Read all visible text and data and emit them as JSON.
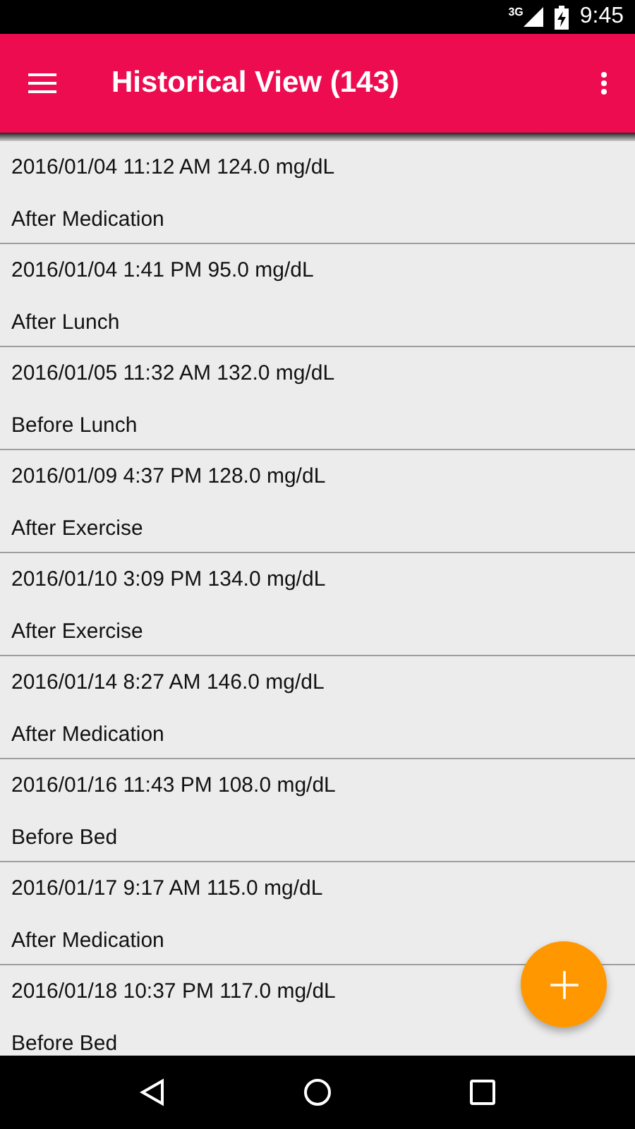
{
  "status_bar": {
    "network": "3G",
    "time": "9:45"
  },
  "app_bar": {
    "title": "Historical View (143)"
  },
  "readings": [
    {
      "reading": "2016/01/04 11:12 AM 124.0 mg/dL",
      "context": "After Medication"
    },
    {
      "reading": "2016/01/04 1:41 PM 95.0 mg/dL",
      "context": "After Lunch"
    },
    {
      "reading": "2016/01/05 11:32 AM 132.0 mg/dL",
      "context": "Before Lunch"
    },
    {
      "reading": "2016/01/09 4:37 PM 128.0 mg/dL",
      "context": "After Exercise"
    },
    {
      "reading": "2016/01/10 3:09 PM 134.0 mg/dL",
      "context": "After Exercise"
    },
    {
      "reading": "2016/01/14 8:27 AM 146.0 mg/dL",
      "context": "After Medication"
    },
    {
      "reading": "2016/01/16 11:43 PM 108.0 mg/dL",
      "context": "Before Bed"
    },
    {
      "reading": "2016/01/17 9:17 AM 115.0 mg/dL",
      "context": "After Medication"
    },
    {
      "reading": "2016/01/18 10:37 PM 117.0 mg/dL",
      "context": "Before Bed"
    }
  ]
}
